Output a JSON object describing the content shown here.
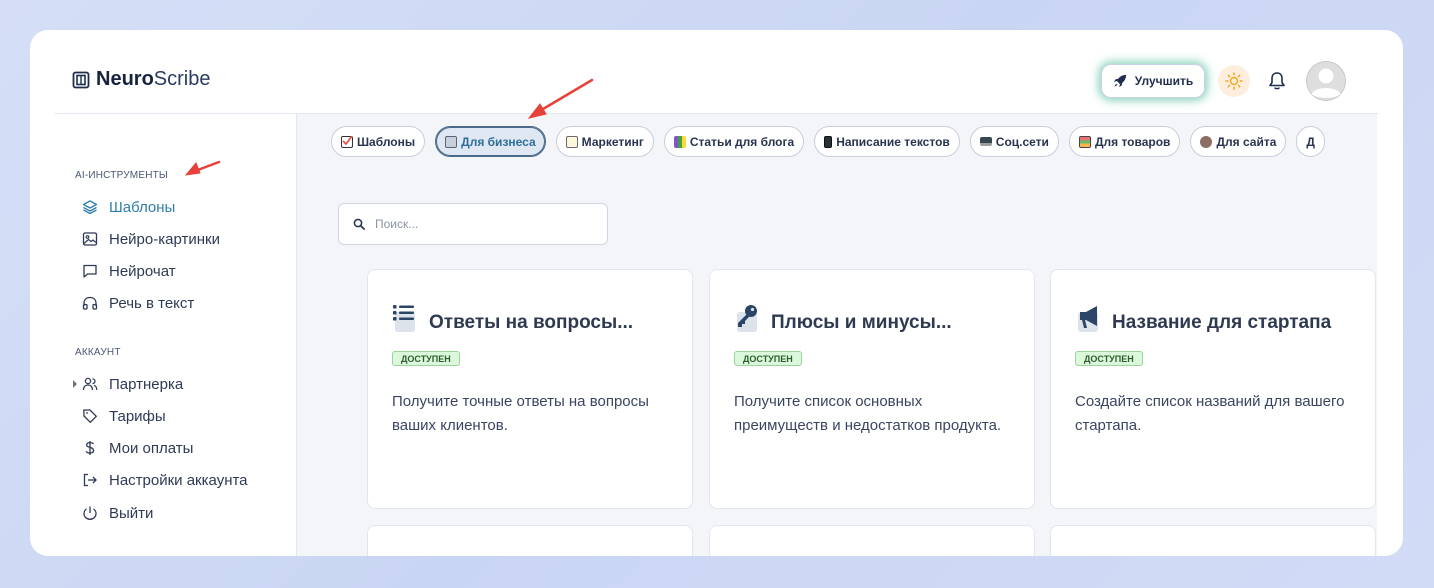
{
  "header": {
    "logo_bold": "Neuro",
    "logo_light": "Scribe",
    "upgrade_label": "Улучшить"
  },
  "sidebar": {
    "section_tools": "AI-ИНСТРУМЕНТЫ",
    "tools": [
      {
        "label": "Шаблоны",
        "icon": "layers-icon",
        "active": true
      },
      {
        "label": "Нейро-картинки",
        "icon": "image-icon"
      },
      {
        "label": "Нейрочат",
        "icon": "chat-icon"
      },
      {
        "label": "Речь в текст",
        "icon": "headphones-icon"
      }
    ],
    "section_account": "АККАУНТ",
    "account": [
      {
        "label": "Партнерка",
        "icon": "users-icon"
      },
      {
        "label": "Тарифы",
        "icon": "tag-icon"
      },
      {
        "label": "Мои оплаты",
        "icon": "dollar-icon"
      },
      {
        "label": "Настройки аккаунта",
        "icon": "logout-arrow-icon"
      },
      {
        "label": "Выйти",
        "icon": "power-icon"
      }
    ]
  },
  "chips": [
    {
      "label": "Шаблоны",
      "icon": "checkbox-emoji"
    },
    {
      "label": "Для бизнеса",
      "icon": "ledger-emoji",
      "active": true
    },
    {
      "label": "Маркетинг",
      "icon": "memo-emoji"
    },
    {
      "label": "Статьи для блога",
      "icon": "bookstack-emoji"
    },
    {
      "label": "Написание текстов",
      "icon": "phone-emoji"
    },
    {
      "label": "Соц.сети",
      "icon": "laptop-emoji"
    },
    {
      "label": "Для товаров",
      "icon": "boxes-emoji"
    },
    {
      "label": "Для сайта",
      "icon": "mask-emoji"
    },
    {
      "label": "Д",
      "icon": ""
    }
  ],
  "search": {
    "placeholder": "Поиск..."
  },
  "cards": [
    {
      "title": "Ответы на вопросы...",
      "badge": "ДОСТУПЕН",
      "description": "Получите точные ответы на вопросы ваших клиентов.",
      "icon": "list-icon"
    },
    {
      "title": "Плюсы и минусы...",
      "badge": "ДОСТУПЕН",
      "description": "Получите список основных преимуществ и недостатков продукта.",
      "icon": "key-icon"
    },
    {
      "title": "Название для стартапа",
      "badge": "ДОСТУПЕН",
      "description": "Создайте список названий для вашего стартапа.",
      "icon": "megaphone-icon"
    }
  ],
  "colors": {
    "accent": "#2f7fa8",
    "badge_bg": "#dcf8dc",
    "annotation_arrow": "#e8413a"
  }
}
